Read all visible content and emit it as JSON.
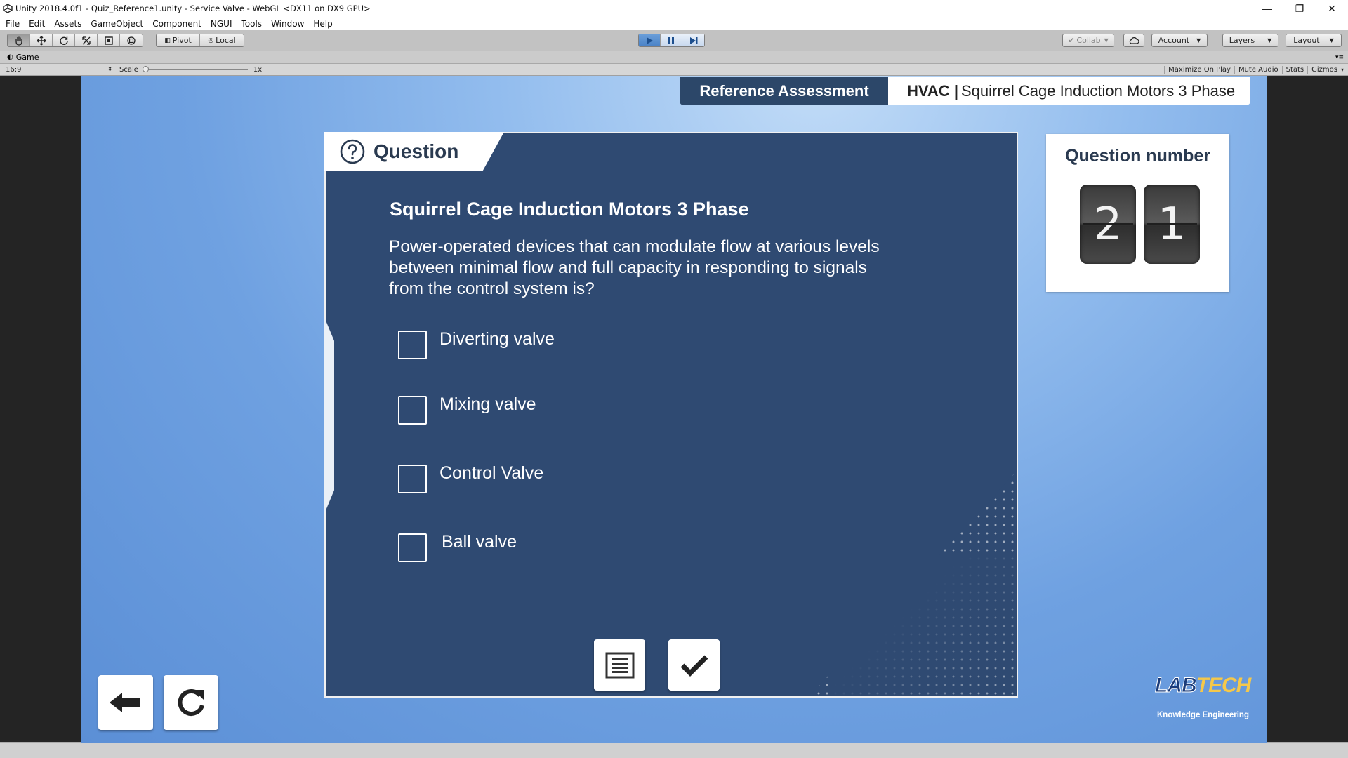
{
  "window": {
    "title": "Unity 2018.4.0f1 - Quiz_Reference1.unity - Service Valve - WebGL <DX11 on DX9 GPU>",
    "controls": [
      "—",
      "❐",
      "✕"
    ]
  },
  "menu": [
    "File",
    "Edit",
    "Assets",
    "GameObject",
    "Component",
    "NGUI",
    "Tools",
    "Window",
    "Help"
  ],
  "toolbar": {
    "pivot": "Pivot",
    "local": "Local",
    "collab": "Collab",
    "account": "Account",
    "layers": "Layers",
    "layout": "Layout"
  },
  "game_tab": {
    "label": "Game",
    "aspect": "16:9",
    "scale_label": "Scale",
    "scale_value": "1x",
    "options": [
      "Maximize On Play",
      "Mute Audio",
      "Stats",
      "Gizmos"
    ]
  },
  "header": {
    "assessment": "Reference Assessment",
    "subject_bold": "HVAC |",
    "subject_rest": "Squirrel Cage Induction Motors 3 Phase"
  },
  "question": {
    "tab_label": "Question",
    "topic": "Squirrel Cage Induction Motors 3 Phase",
    "text": "Power-operated devices that can modulate flow at various levels between minimal flow and full capacity in responding to signals from the control system is?",
    "options": [
      "Diverting valve",
      "Mixing valve",
      "Control Valve",
      "Ball valve"
    ]
  },
  "question_number": {
    "title": "Question number",
    "digits": [
      "2",
      "1"
    ]
  },
  "logo": {
    "brand_left": "LAB",
    "brand_right": "TECH",
    "tagline": "Knowledge Engineering"
  },
  "colors": {
    "panel": "#2f4a72",
    "header_dark": "#2c4769",
    "play_active": "#4a82c6"
  }
}
